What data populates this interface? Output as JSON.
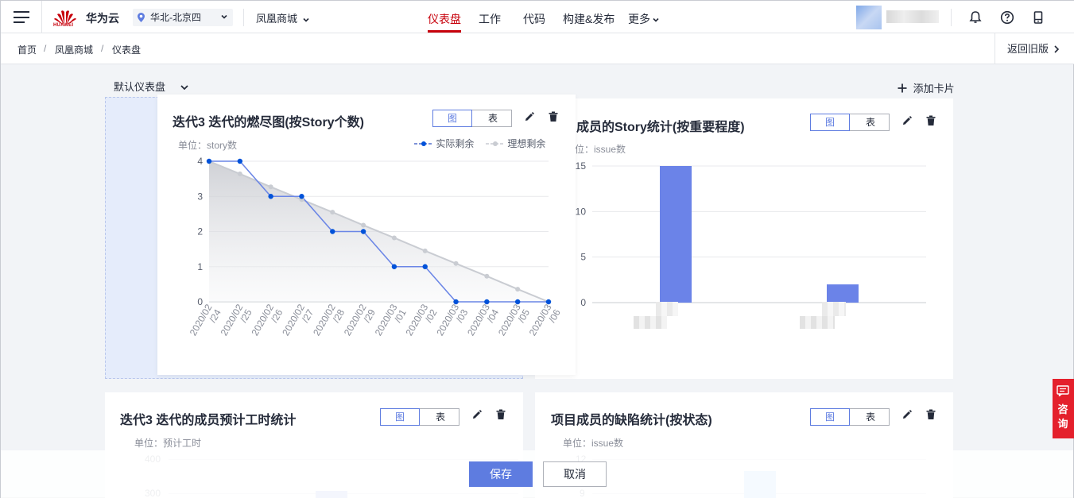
{
  "topbar": {
    "logo_text": "HUAWEI",
    "brand": "华为云",
    "region": "华北-北京四",
    "project": "凤凰商城",
    "nav": [
      {
        "label": "仪表盘",
        "active": true
      },
      {
        "label": "工作",
        "active": false
      },
      {
        "label": "代码",
        "active": false
      },
      {
        "label": "构建&发布",
        "active": false
      },
      {
        "label": "更多",
        "active": false
      }
    ]
  },
  "breadcrumb": {
    "items": [
      "首页",
      "凤凰商城",
      "仪表盘"
    ],
    "separator": "/",
    "back_old": "返回旧版"
  },
  "dashboard": {
    "selector": "默认仪表盘",
    "add_card": "添加卡片"
  },
  "cards": {
    "burndown": {
      "title": "迭代3 迭代的燃尽图(按Story个数)",
      "toggle_chart": "图",
      "toggle_table": "表",
      "unit": "单位：story数",
      "legend_actual": "实际剩余",
      "legend_ideal": "理想剩余"
    },
    "story_stats": {
      "title": "成员的Story统计(按重要程度)",
      "toggle_chart": "图",
      "toggle_table": "表",
      "unit": "位：issue数"
    },
    "hours": {
      "title": "迭代3 迭代的成员预计工时统计",
      "toggle_chart": "图",
      "toggle_table": "表",
      "unit": "单位：预计工时",
      "y_ticks": [
        "400",
        "300"
      ]
    },
    "defects": {
      "title": "项目成员的缺陷统计(按状态)",
      "toggle_chart": "图",
      "toggle_table": "表",
      "unit": "单位：issue数",
      "y_ticks": [
        "12",
        "9"
      ]
    }
  },
  "footer": {
    "save": "保存",
    "cancel": "取消"
  },
  "float": {
    "consult": "咨询"
  },
  "colors": {
    "brand_red": "#c7000b",
    "primary_blue": "#5e7ce0",
    "line_blue": "#526ecc",
    "ideal_gray": "#c9ccd2"
  },
  "chart_data": [
    {
      "type": "line",
      "title": "迭代3 迭代的燃尽图(按Story个数)",
      "ylabel": "单位：story数",
      "x": [
        "2020/02/24",
        "2020/02/25",
        "2020/02/26",
        "2020/02/27",
        "2020/02/28",
        "2020/02/29",
        "2020/03/01",
        "2020/03/02",
        "2020/03/03",
        "2020/03/04",
        "2020/03/05",
        "2020/03/06"
      ],
      "x_tick_labels": [
        [
          "2020/02",
          "/24"
        ],
        [
          "2020/02",
          "/25"
        ],
        [
          "2020/02",
          "/26"
        ],
        [
          "2020/02",
          "/27"
        ],
        [
          "2020/02",
          "/28"
        ],
        [
          "2020/02",
          "/29"
        ],
        [
          "2020/03",
          "/01"
        ],
        [
          "2020/03",
          "/02"
        ],
        [
          "2020/03",
          "/03"
        ],
        [
          "2020/03",
          "/04"
        ],
        [
          "2020/03",
          "/05"
        ],
        [
          "2020/03",
          "/06"
        ]
      ],
      "series": [
        {
          "name": "实际剩余",
          "values": [
            4,
            4,
            3,
            3,
            2,
            2,
            1,
            1,
            0,
            0,
            0,
            0
          ]
        },
        {
          "name": "理想剩余",
          "values": [
            4,
            3.64,
            3.27,
            2.91,
            2.55,
            2.18,
            1.82,
            1.45,
            1.09,
            0.73,
            0.36,
            0
          ]
        }
      ],
      "y_ticks": [
        0,
        1,
        2,
        3,
        4
      ],
      "ylim": [
        0,
        4
      ],
      "grid": true,
      "legend_position": "top-right"
    },
    {
      "type": "bar",
      "title": "成员的Story统计(按重要程度)",
      "ylabel": "位：issue数",
      "categories": [
        "",
        ""
      ],
      "values": [
        15,
        2
      ],
      "y_ticks": [
        0,
        5,
        10,
        15
      ],
      "ylim": [
        0,
        15
      ],
      "grid": true
    }
  ]
}
